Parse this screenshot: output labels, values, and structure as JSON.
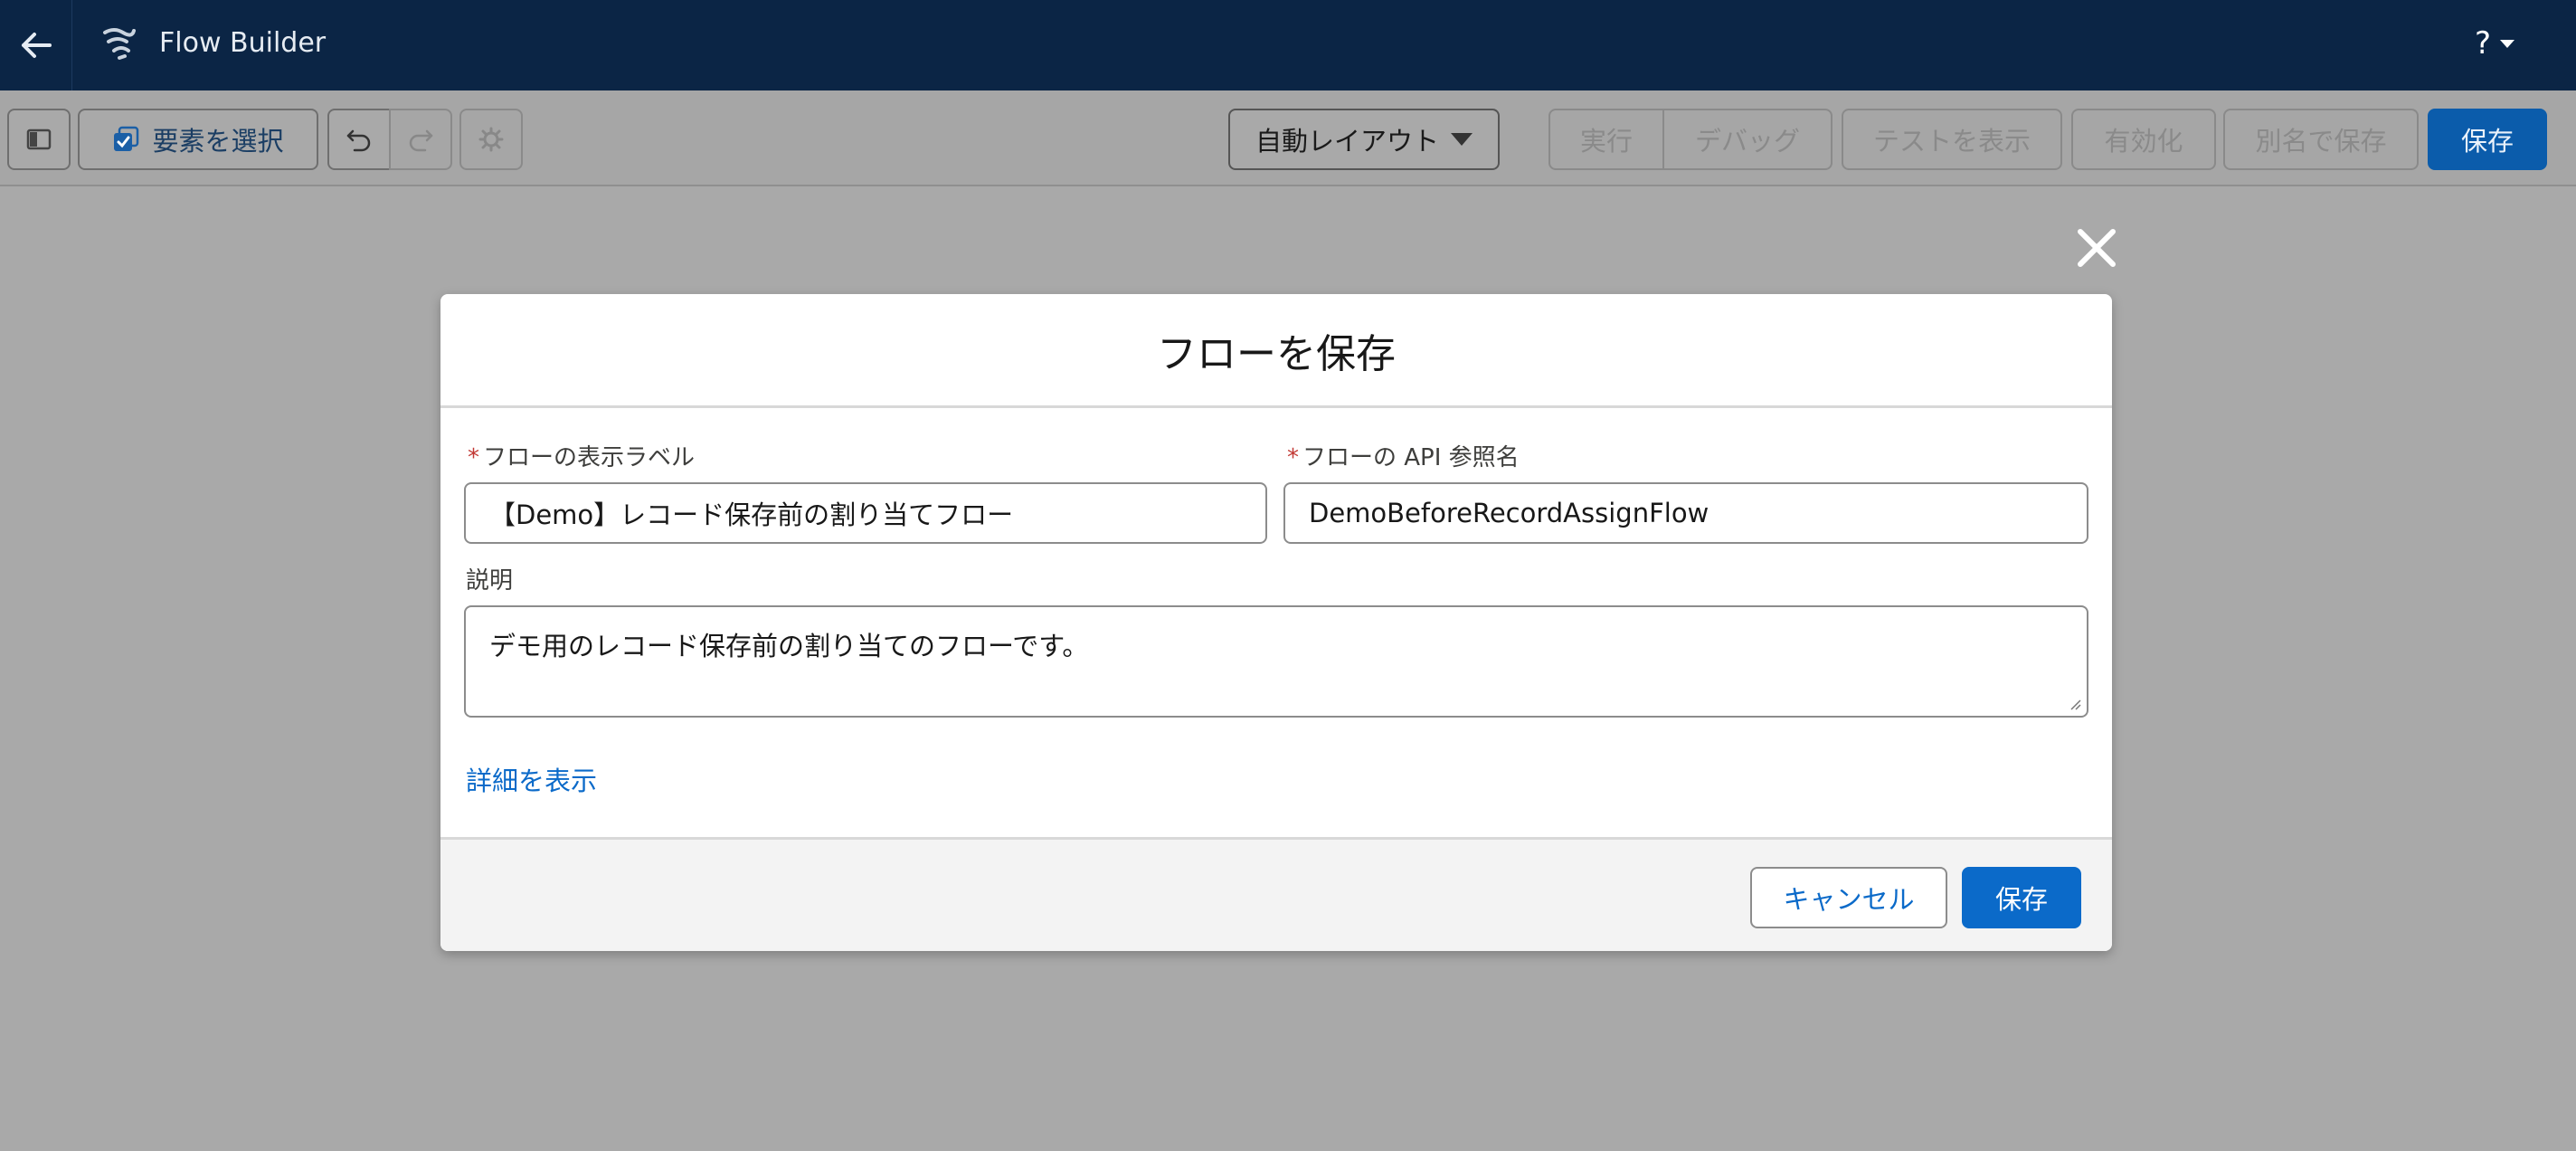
{
  "header": {
    "app_title": "Flow Builder",
    "help_label": "?"
  },
  "toolbar": {
    "select_elements_label": "要素を選択",
    "layout_label": "自動レイアウト",
    "run_label": "実行",
    "debug_label": "デバッグ",
    "view_tests_label": "テストを表示",
    "activate_label": "有効化",
    "save_as_label": "別名で保存",
    "save_label": "保存"
  },
  "modal": {
    "title": "フローを保存",
    "label_field": {
      "label": "フローの表示ラベル",
      "required": "*",
      "value": "【Demo】レコード保存前の割り当てフロー"
    },
    "api_field": {
      "label": "フローの API 参照名",
      "required": "*",
      "value": "DemoBeforeRecordAssignFlow"
    },
    "description_field": {
      "label": "説明",
      "value": "デモ用のレコード保存前の割り当てのフローです。"
    },
    "show_details_link": "詳細を表示",
    "cancel_label": "キャンセル",
    "save_label": "保存"
  },
  "colors": {
    "header_bg": "#0b2545",
    "overlay_bg": "#a9a9a9",
    "brand": "#0b6ac9",
    "required": "#c23934"
  },
  "icons": [
    "back-arrow-icon",
    "flow-builder-icon",
    "toggle-panel-icon",
    "select-elements-icon",
    "undo-icon",
    "redo-icon",
    "settings-gear-icon",
    "chevron-down-icon",
    "close-icon"
  ]
}
